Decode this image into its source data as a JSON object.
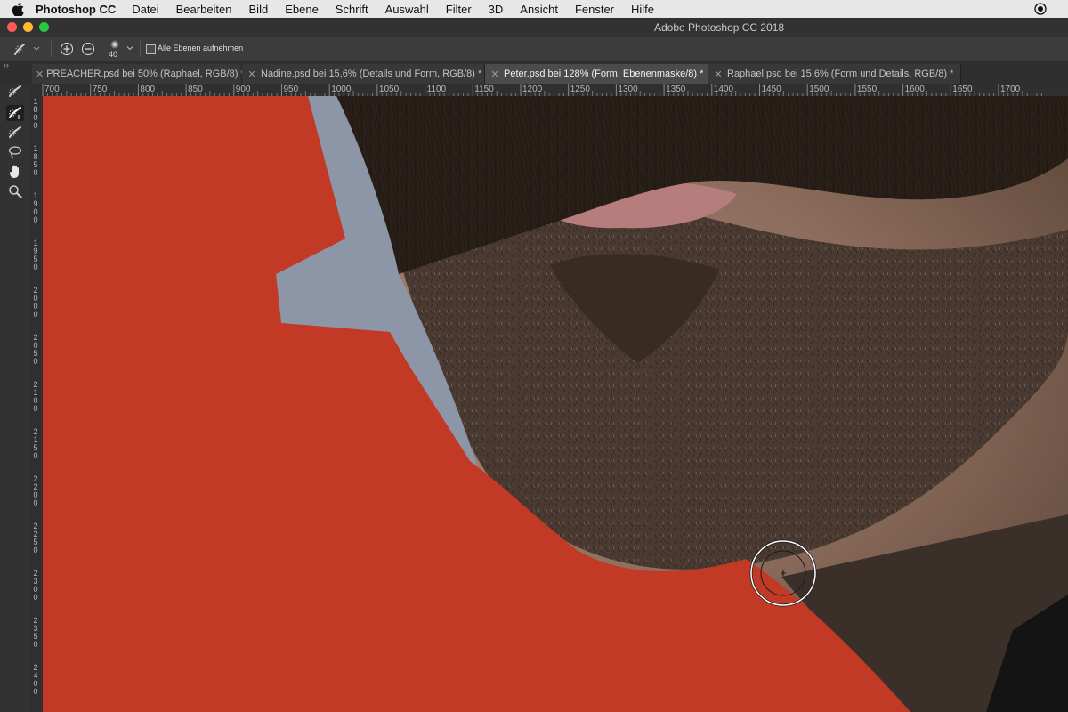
{
  "menubar": {
    "app_name": "Photoshop CC",
    "items": [
      "Datei",
      "Bearbeiten",
      "Bild",
      "Ebene",
      "Schrift",
      "Auswahl",
      "Filter",
      "3D",
      "Ansicht",
      "Fenster",
      "Hilfe"
    ]
  },
  "window": {
    "title": "Adobe Photoshop CC 2018"
  },
  "options": {
    "brush_size": "40",
    "sample_all_layers_label": "Alle Ebenen aufnehmen",
    "sample_all_layers_checked": false
  },
  "tabs": [
    {
      "label": "PREACHER.psd bei 50% (Raphael, RGB/8) *",
      "active": false
    },
    {
      "label": "Nadine.psd bei 15,6% (Details und Form, RGB/8) *",
      "active": false
    },
    {
      "label": "Peter.psd bei 128% (Form, Ebenenmaske/8) *",
      "active": true
    },
    {
      "label": "Raphael.psd bei 15,6% (Form und Details, RGB/8) *",
      "active": false
    }
  ],
  "tools": [
    {
      "name": "quick-selection-tool-icon"
    },
    {
      "name": "quick-selection-add-tool-icon",
      "active": true
    },
    {
      "name": "quick-selection-subtract-tool-icon"
    },
    {
      "name": "lasso-tool-icon"
    },
    {
      "name": "hand-tool-icon"
    },
    {
      "name": "zoom-tool-icon"
    }
  ],
  "ruler": {
    "horizontal_labels": [
      "700",
      "750",
      "800",
      "850",
      "900",
      "950",
      "1000",
      "1050",
      "1100",
      "1150",
      "1200",
      "1250",
      "1300",
      "1350",
      "1400",
      "1450",
      "1500",
      "1550",
      "1600",
      "1650",
      "1700"
    ],
    "vertical_labels": [
      "1800",
      "1850",
      "1900",
      "1950",
      "2000",
      "2050",
      "2100",
      "2150",
      "2200",
      "2250",
      "2300",
      "2350",
      "2400"
    ]
  },
  "colors": {
    "mask_overlay": "#c23a26",
    "background_gray": "#8c96a6",
    "active_tab": "#4b4b4b"
  }
}
